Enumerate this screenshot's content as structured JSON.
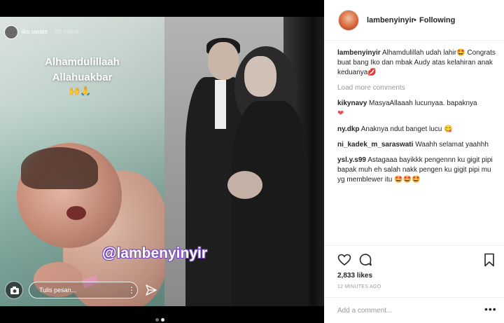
{
  "story": {
    "username": "iko.uwais",
    "time": "30 menit",
    "title_line1": "Alhamdulillaah",
    "title_line2": "Allahuakbar",
    "hands": "🙌🙏",
    "reply_placeholder": "Tulis pesan...",
    "kebab": "⋮"
  },
  "watermark": "@lambenyinyir",
  "carousel": {
    "count": 2,
    "active": 1
  },
  "post": {
    "username": "lambenyinyir",
    "separator": "•",
    "follow_state": "Following",
    "caption_user": "lambenyinyir",
    "caption_text": "Alhamdulillah udah lahir",
    "caption_text2": "Congrats buat bang Iko dan mbak Audy atas kelahiran anak keduanya",
    "caption_emoji1": "🤩",
    "caption_emoji2": "💋",
    "load_more": "Load more comments",
    "comments": [
      {
        "user": "kikynavy",
        "text": "MasyaAllaaah lucunyaa. bapaknya",
        "emoji": "❤"
      },
      {
        "user": "ny.dkp",
        "text": "Anaknya ndut banget lucu",
        "emoji": "😋"
      },
      {
        "user": "ni_kadek_m_saraswati",
        "text": "Waahh selamat yaahhh",
        "emoji": ""
      },
      {
        "user": "ysl.y.s99",
        "text": "Astagaaa bayikkk pengennn ku gigit pipi bapak muh eh salah nakk pengen ku gigit pipi mu yg memblewer itu",
        "emoji": "🤩🤩🤩"
      }
    ],
    "likes": "2,833 likes",
    "timestamp": "12 MINUTES AGO",
    "add_comment_placeholder": "Add a comment...",
    "more": "•••"
  }
}
